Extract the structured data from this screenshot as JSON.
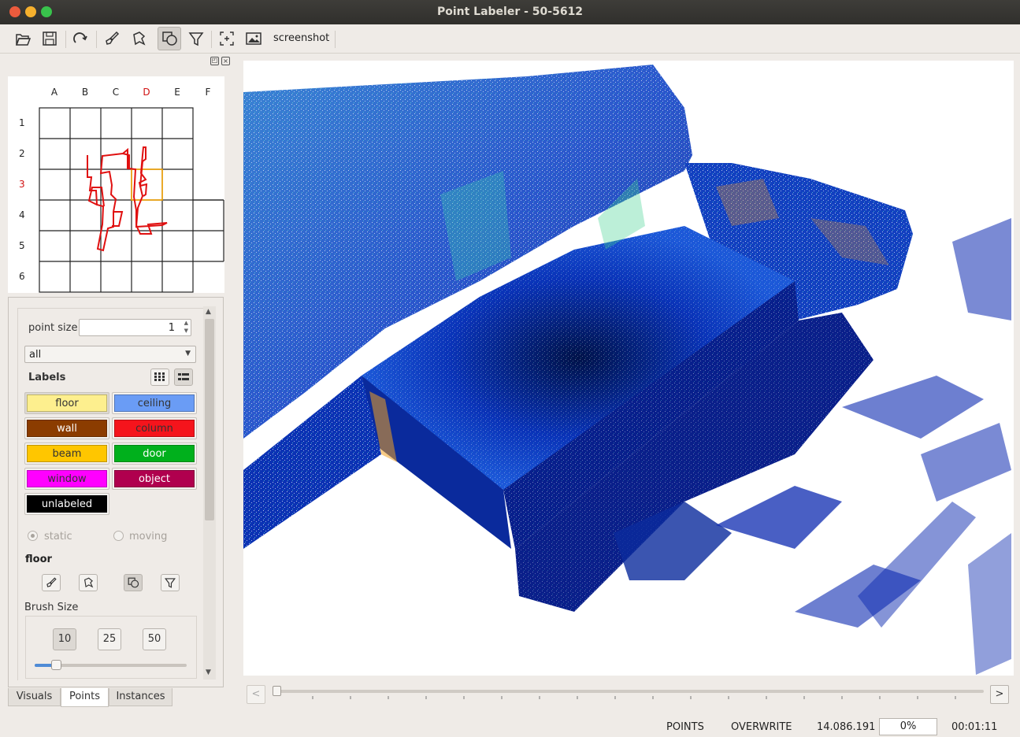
{
  "window": {
    "title": "Point Labeler - 50-5612"
  },
  "toolbar": {
    "screenshot_label": "screenshot"
  },
  "minimap": {
    "columns": [
      "A",
      "B",
      "C",
      "D",
      "E",
      "F"
    ],
    "rows": [
      "1",
      "2",
      "3",
      "4",
      "5",
      "6"
    ],
    "highlight_column": "D",
    "highlight_row": "3"
  },
  "points_panel": {
    "point_size_label": "point size",
    "point_size_value": "1",
    "filter_selected": "all",
    "labels_heading": "Labels",
    "labels": [
      {
        "name": "floor",
        "color": "#fdef8e"
      },
      {
        "name": "ceiling",
        "color": "#6a9cf5"
      },
      {
        "name": "wall",
        "color": "#8b3c00"
      },
      {
        "name": "column",
        "color": "#f5141c"
      },
      {
        "name": "beam",
        "color": "#ffc600"
      },
      {
        "name": "door",
        "color": "#00b01c"
      },
      {
        "name": "window",
        "color": "#ff00ff"
      },
      {
        "name": "object",
        "color": "#b0004e"
      },
      {
        "name": "unlabeled",
        "color": "#000000"
      }
    ],
    "static_label": "static",
    "moving_label": "moving",
    "current_label": "floor",
    "brush_size_label": "Brush Size",
    "brush_sizes": [
      "10",
      "25",
      "50"
    ]
  },
  "tabs": [
    "Visuals",
    "Points",
    "Instances"
  ],
  "active_tab": "Points",
  "timeline": {
    "prev": "<",
    "next": ">"
  },
  "statusbar": {
    "mode": "POINTS",
    "write_mode": "OVERWRITE",
    "point_count": "14.086.191",
    "progress": "0%",
    "time": "00:01:11"
  },
  "colors": {
    "accent": "#f0a000",
    "trajectory": "#e01010",
    "highlight": "#d01010"
  }
}
